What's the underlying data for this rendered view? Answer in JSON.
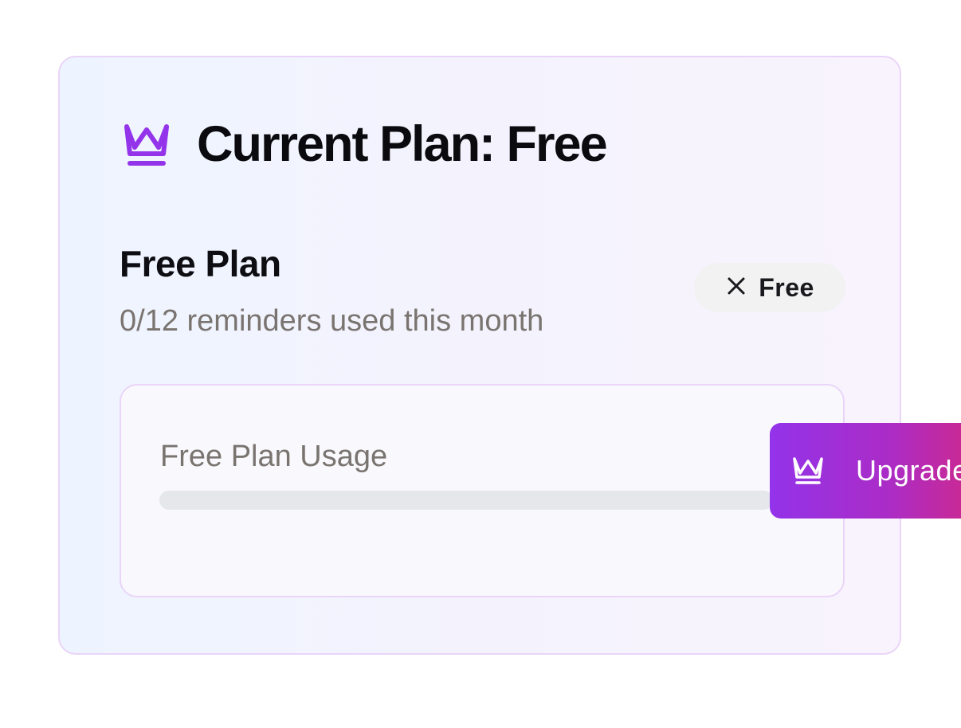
{
  "header": {
    "title": "Current Plan: Free",
    "icon": "crown-icon"
  },
  "plan": {
    "name": "Free Plan",
    "usage_text": "0/12 reminders used this month",
    "reminders_used": 0,
    "reminders_limit": 12
  },
  "badge": {
    "label": "Free",
    "icon": "x-icon"
  },
  "usage_box": {
    "label": "Free Plan Usage",
    "progress_fraction": 0
  },
  "upgrade_button": {
    "label": "Upgrade",
    "icon": "crown-icon"
  },
  "colors": {
    "accent": "#9333ea",
    "accent_end": "#db2777",
    "border": "#ead5f8",
    "track": "#e6e7ea",
    "muted_text": "#7a7470"
  }
}
